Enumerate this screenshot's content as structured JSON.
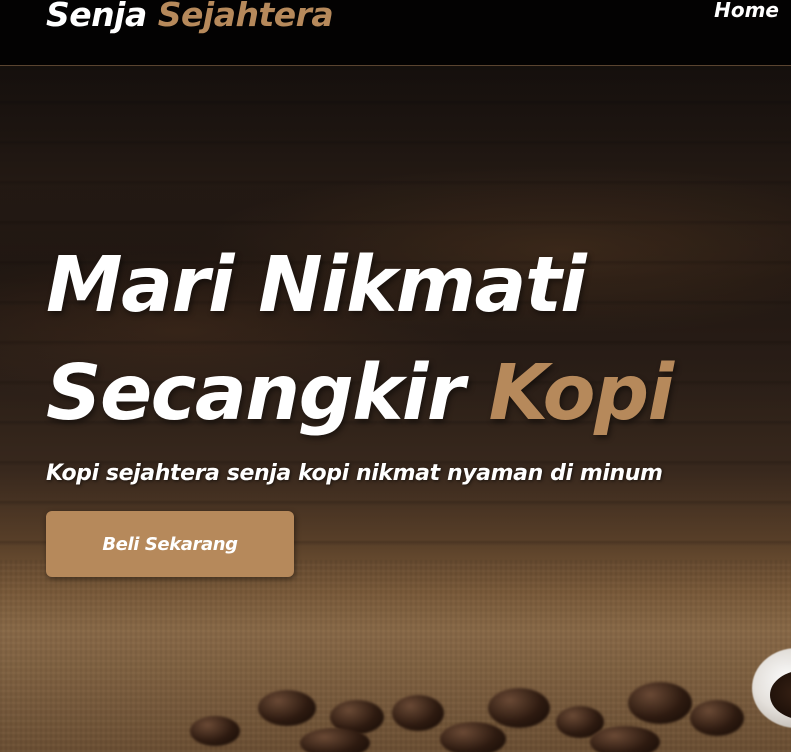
{
  "brand": {
    "name_primary": "Senja",
    "name_accent": "Sejahtera",
    "accent_color": "#b6895b"
  },
  "nav": {
    "items": [
      {
        "label": "Home"
      }
    ]
  },
  "hero": {
    "title_line1": "Mari Nikmati",
    "title_line2_main": "Secangkir ",
    "title_line2_accent": "Kopi",
    "subtitle": "Kopi sejahtera senja kopi nikmat nyaman di minum",
    "cta_label": "Beli Sekarang",
    "background_image": "coffee-beans-on-burlap-photo"
  },
  "colors": {
    "navbar_bg": "#030202",
    "accent": "#b6895b",
    "text": "#ffffff"
  }
}
